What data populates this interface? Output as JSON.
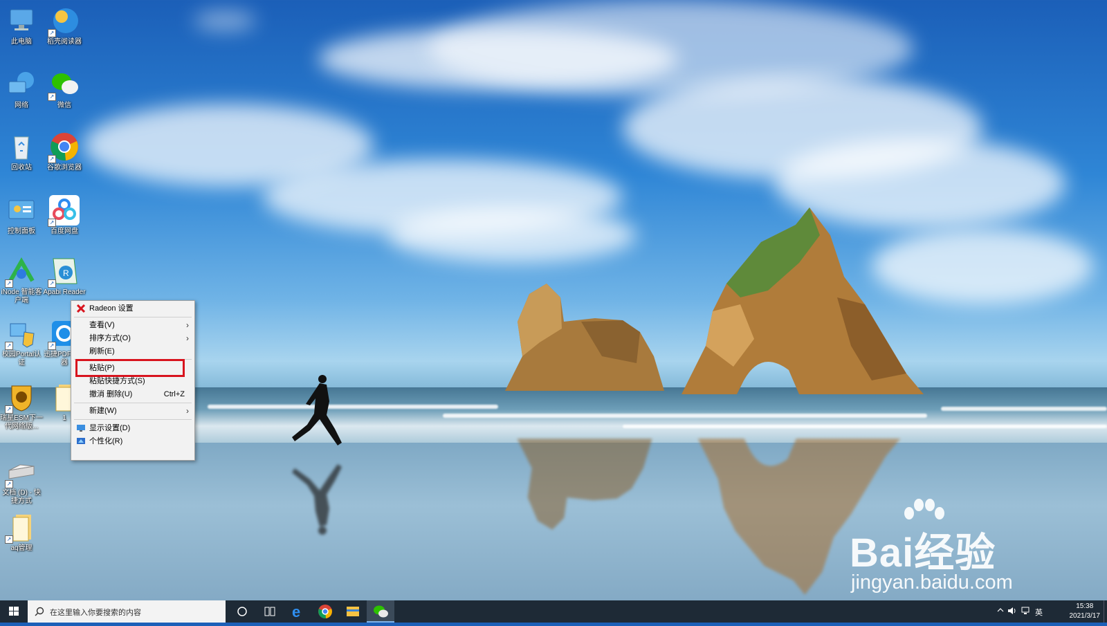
{
  "desktop": {
    "icons": [
      {
        "label": "此电脑",
        "icon": "computer-icon"
      },
      {
        "label": "稻壳阅读器",
        "icon": "reader-app-icon"
      },
      {
        "label": "网络",
        "icon": "network-icon"
      },
      {
        "label": "微信",
        "icon": "wechat-icon"
      },
      {
        "label": "回收站",
        "icon": "recycle-bin-icon"
      },
      {
        "label": "谷歌浏览器",
        "icon": "chrome-icon"
      },
      {
        "label": "控制面板",
        "icon": "control-panel-icon"
      },
      {
        "label": "百度网盘",
        "icon": "baidu-netdisk-icon"
      },
      {
        "label": "iNode 智能客户端",
        "icon": "inode-client-icon"
      },
      {
        "label": "Apabi Reader",
        "icon": "apabi-reader-icon"
      },
      {
        "label": "校园Portal认证",
        "icon": "portal-auth-icon"
      },
      {
        "label": "迅捷PDF转换器",
        "icon": "pdf-converter-icon"
      },
      {
        "label": "瑞星ESM下一代网络版...",
        "icon": "rising-antivirus-icon"
      },
      {
        "label": "1",
        "icon": "folder-icon"
      },
      {
        "label": "文档 (D) - 快捷方式",
        "icon": "drive-shortcut-icon"
      },
      {
        "label": "aq管理",
        "icon": "folder-icon"
      }
    ]
  },
  "context_menu": {
    "items": [
      {
        "label": "Radeon 设置",
        "icon": "radeon-icon"
      },
      {
        "label": "查看(V)",
        "submenu": true
      },
      {
        "label": "排序方式(O)",
        "submenu": true
      },
      {
        "label": "刷新(E)"
      },
      {
        "label": "粘贴(P)",
        "highlighted": true
      },
      {
        "label": "粘贴快捷方式(S)"
      },
      {
        "label": "撤消 删除(U)",
        "shortcut": "Ctrl+Z"
      },
      {
        "label": "新建(W)",
        "submenu": true
      },
      {
        "label": "显示设置(D)",
        "icon": "display-settings-icon"
      },
      {
        "label": "个性化(R)",
        "icon": "personalize-icon"
      }
    ],
    "highlight_color": "#d8141e"
  },
  "taskbar": {
    "search_placeholder": "在这里输入你要搜索的内容",
    "pinned": [
      "cortana-icon",
      "task-view-icon",
      "edge-icon",
      "chrome-icon",
      "file-explorer-icon",
      "wechat-icon"
    ],
    "tray": {
      "ime": "英"
    },
    "clock": {
      "time": "15:38",
      "date": "2021/3/17"
    }
  },
  "watermark": {
    "brand": "Bai经验",
    "url": "jingyan.baidu.com"
  }
}
